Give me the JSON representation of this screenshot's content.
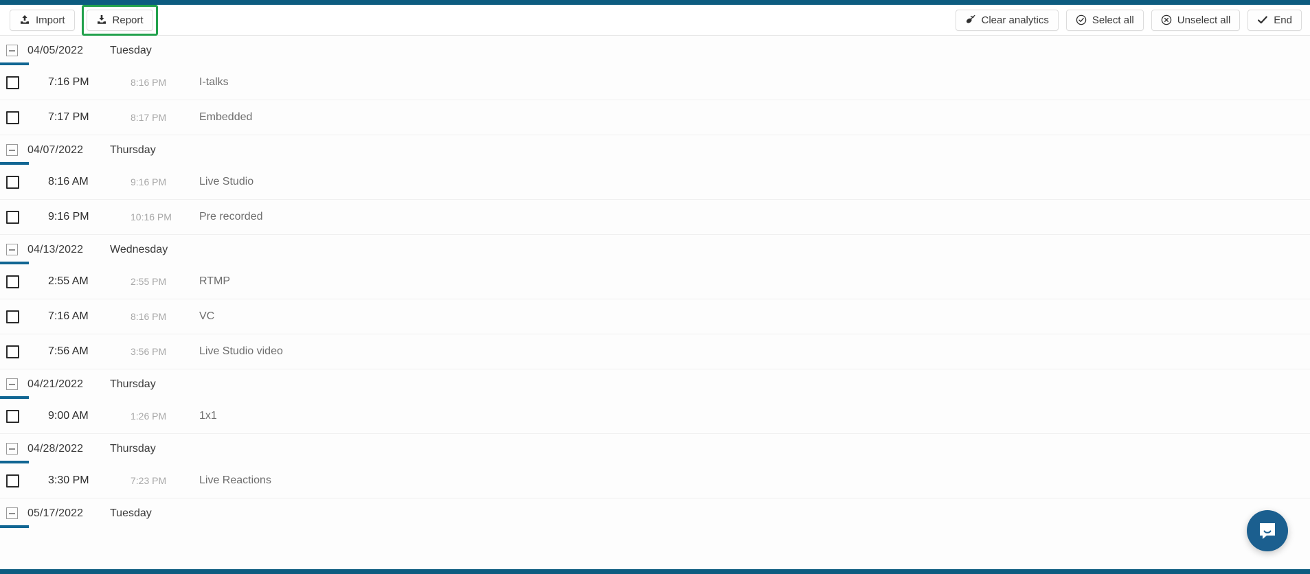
{
  "theme": {
    "accent_bar": "#0d5c80",
    "group_underline": "#116693",
    "highlight_ring": "#22a14c",
    "chat_bubble": "#1b5f8f"
  },
  "toolbar": {
    "left_buttons": [
      {
        "label": "Import",
        "icon": "upload-icon",
        "highlighted": false
      },
      {
        "label": "Report",
        "icon": "download-icon",
        "highlighted": true
      }
    ],
    "right_buttons": [
      {
        "label": "Clear analytics",
        "icon": "broom-icon"
      },
      {
        "label": "Select all",
        "icon": "check-circle-icon"
      },
      {
        "label": "Unselect all",
        "icon": "x-circle-icon"
      },
      {
        "label": "End",
        "icon": "check-icon"
      }
    ]
  },
  "chat": {
    "launcher_label": "Open chat",
    "icon": "chat-bubble-icon"
  },
  "list": {
    "groups": [
      {
        "date": "04/05/2022",
        "weekday": "Tuesday",
        "collapsed": false,
        "rows": [
          {
            "checked": false,
            "start": "7:16 PM",
            "end": "8:16 PM",
            "title": "I-talks"
          },
          {
            "checked": false,
            "start": "7:17 PM",
            "end": "8:17 PM",
            "title": "Embedded"
          }
        ]
      },
      {
        "date": "04/07/2022",
        "weekday": "Thursday",
        "collapsed": false,
        "rows": [
          {
            "checked": false,
            "start": "8:16 AM",
            "end": "9:16 PM",
            "title": "Live Studio"
          },
          {
            "checked": false,
            "start": "9:16 PM",
            "end": "10:16 PM",
            "title": "Pre recorded"
          }
        ]
      },
      {
        "date": "04/13/2022",
        "weekday": "Wednesday",
        "collapsed": false,
        "rows": [
          {
            "checked": false,
            "start": "2:55 AM",
            "end": "2:55 PM",
            "title": "RTMP"
          },
          {
            "checked": false,
            "start": "7:16 AM",
            "end": "8:16 PM",
            "title": "VC"
          },
          {
            "checked": false,
            "start": "7:56 AM",
            "end": "3:56 PM",
            "title": "Live Studio video"
          }
        ]
      },
      {
        "date": "04/21/2022",
        "weekday": "Thursday",
        "collapsed": false,
        "rows": [
          {
            "checked": false,
            "start": "9:00 AM",
            "end": "1:26 PM",
            "title": "1x1"
          }
        ]
      },
      {
        "date": "04/28/2022",
        "weekday": "Thursday",
        "collapsed": false,
        "rows": [
          {
            "checked": false,
            "start": "3:30 PM",
            "end": "7:23 PM",
            "title": "Live Reactions"
          }
        ]
      },
      {
        "date": "05/17/2022",
        "weekday": "Tuesday",
        "collapsed": false,
        "rows": []
      }
    ]
  }
}
